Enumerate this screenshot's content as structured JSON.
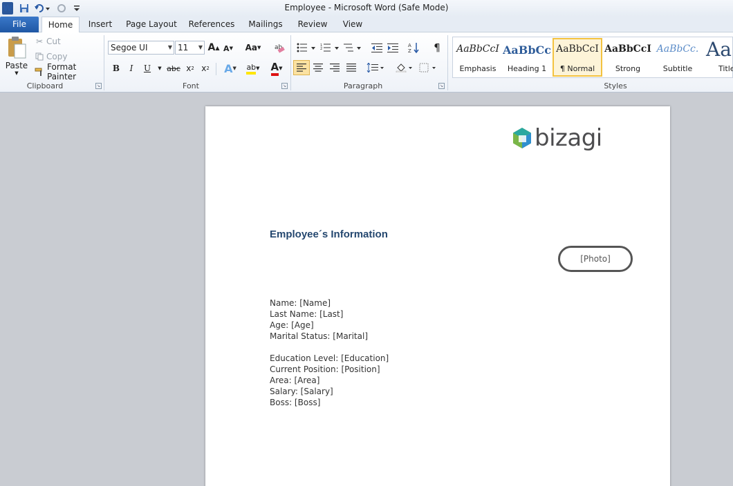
{
  "window": {
    "title": "Employee  -  Microsoft Word (Safe Mode)",
    "word_icon": "W"
  },
  "tabs": [
    "File",
    "Home",
    "Insert",
    "Page Layout",
    "References",
    "Mailings",
    "Review",
    "View"
  ],
  "ribbon": {
    "clipboard": {
      "label": "Clipboard",
      "paste": "Paste",
      "cut": "Cut",
      "copy": "Copy",
      "format_painter": "Format Painter"
    },
    "font": {
      "label": "Font",
      "font_name": "Segoe UI",
      "font_size": "11",
      "grow": "A",
      "shrink": "A",
      "change_case": "Aa",
      "bold": "B",
      "italic": "I",
      "underline": "U",
      "strikethrough": "abc",
      "subscript": "x",
      "superscript": "x",
      "text_effects": "A",
      "highlight": "ab",
      "font_color": "A"
    },
    "paragraph": {
      "label": "Paragraph",
      "pilcrow": "¶"
    },
    "styles": {
      "label": "Styles",
      "items": [
        {
          "preview": "AaBbCcI",
          "name": "Emphasis"
        },
        {
          "preview": "AaBbCc",
          "name": "Heading 1"
        },
        {
          "preview": "AaBbCcI",
          "name": "¶ Normal"
        },
        {
          "preview": "AaBbCcI",
          "name": "Strong"
        },
        {
          "preview": "AaBbCc.",
          "name": "Subtitle"
        },
        {
          "preview": "Aa",
          "name": "Title"
        }
      ]
    }
  },
  "document": {
    "logo_text": "bizagi",
    "heading": "Employee´s Information",
    "photo_placeholder": "[Photo]",
    "fields": [
      "Name: [Name]",
      "Last Name: [Last]",
      "Age: [Age]",
      "Marital Status: [Marital]",
      "",
      "Education Level: [Education]",
      "Current Position: [Position]",
      "Area: [Area]",
      "Salary: [Salary]",
      "Boss: [Boss]"
    ]
  },
  "colors": {
    "file_tab": "#2b5fad",
    "heading": "#24476f",
    "logo_green": "#7ab648",
    "logo_blue": "#2f8fcf",
    "logo_teal": "#2aa8a0",
    "style_selected": "#f3c240"
  }
}
